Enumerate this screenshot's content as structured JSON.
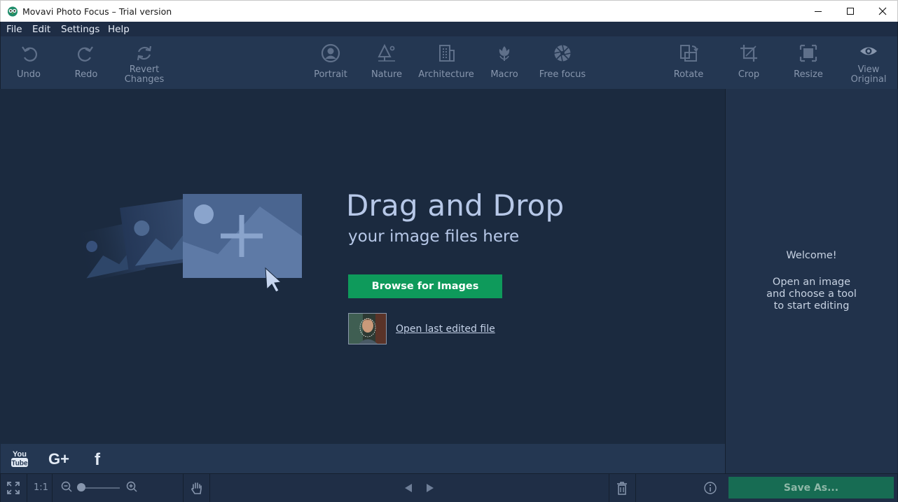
{
  "window": {
    "title": "Movavi Photo Focus – Trial version"
  },
  "menu": [
    "File",
    "Edit",
    "Settings",
    "Help"
  ],
  "toolbar": {
    "undo": "Undo",
    "redo": "Redo",
    "revert_1": "Revert",
    "revert_2": "Changes",
    "portrait": "Portrait",
    "nature": "Nature",
    "architecture": "Architecture",
    "macro": "Macro",
    "free_focus": "Free focus",
    "rotate": "Rotate",
    "crop": "Crop",
    "resize": "Resize",
    "view_original_1": "View",
    "view_original_2": "Original"
  },
  "main": {
    "title": "Drag and Drop",
    "subtitle": "your image files here",
    "browse_label": "Browse for Images",
    "last_file_label": "Open last edited file"
  },
  "panel": {
    "welcome": "Welcome!",
    "hint": "Open an image\nand choose a tool\nto start editing"
  },
  "statusbar": {
    "ratio": "1:1",
    "save_label": "Save As..."
  },
  "colors": {
    "accent_green": "#0e9a5b",
    "toolbar_bg": "#243752",
    "main_bg": "#1b2a3f"
  }
}
